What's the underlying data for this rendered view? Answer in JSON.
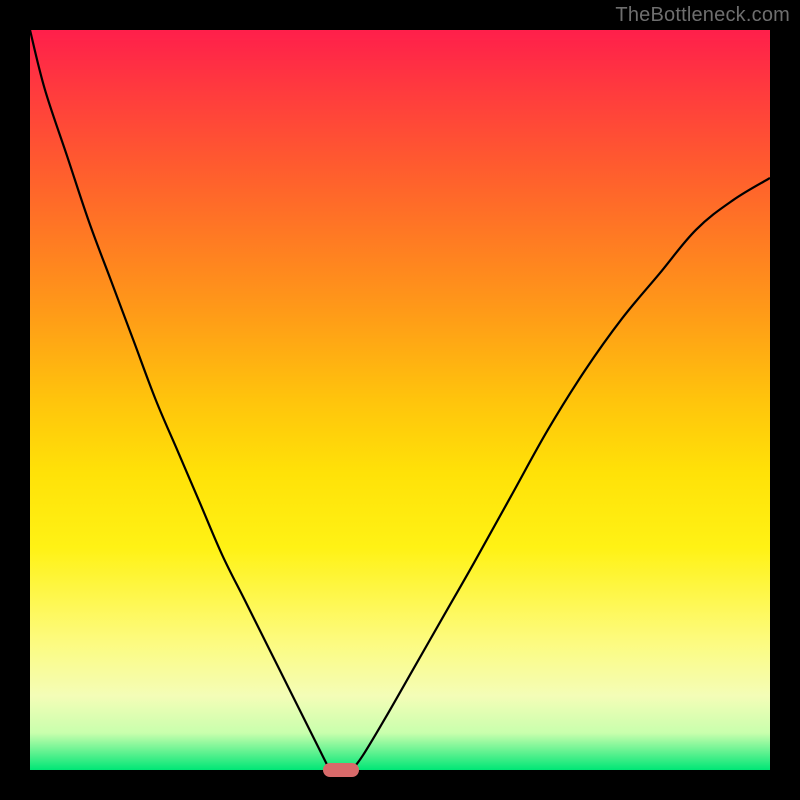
{
  "watermark": "TheBottleneck.com",
  "colors": {
    "frame": "#000000",
    "curve": "#000000",
    "marker": "#d86a6a"
  },
  "chart_data": {
    "type": "line",
    "title": "",
    "xlabel": "",
    "ylabel": "",
    "xlim": [
      0,
      100
    ],
    "ylim": [
      0,
      100
    ],
    "grid": false,
    "legend": false,
    "background": "gradient red→yellow→green (top→bottom)",
    "series": [
      {
        "name": "left-branch",
        "x": [
          0,
          2,
          5,
          8,
          11,
          14,
          17,
          20,
          23,
          26,
          29,
          32,
          35,
          38,
          39.5,
          40.5
        ],
        "y": [
          100,
          92,
          83,
          74,
          66,
          58,
          50,
          43,
          36,
          29,
          23,
          17,
          11,
          5,
          2,
          0
        ]
      },
      {
        "name": "right-branch",
        "x": [
          43.5,
          45,
          48,
          52,
          56,
          60,
          65,
          70,
          75,
          80,
          85,
          90,
          95,
          100
        ],
        "y": [
          0,
          2,
          7,
          14,
          21,
          28,
          37,
          46,
          54,
          61,
          67,
          73,
          77,
          80
        ]
      }
    ],
    "marker": {
      "x": 42,
      "y": 0,
      "shape": "rounded-rect"
    }
  }
}
